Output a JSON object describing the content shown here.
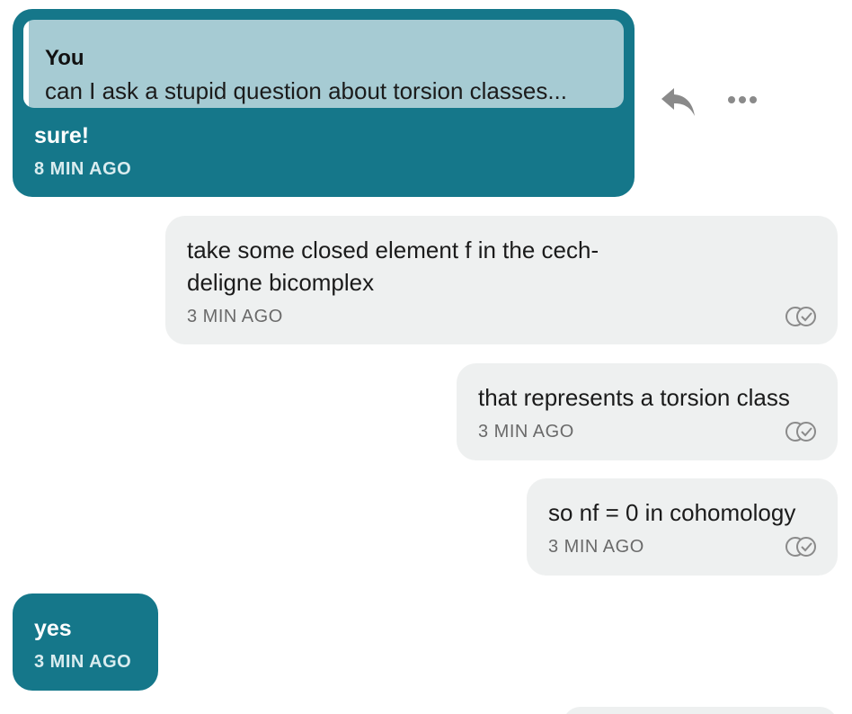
{
  "messages": [
    {
      "reply_to": {
        "author": "You",
        "text": "can I ask a stupid question about torsion classes..."
      },
      "text": "sure!",
      "time": "8 MIN AGO"
    },
    {
      "text_lines": [
        "take some closed element f in the cech-",
        "deligne bicomplex"
      ],
      "time": "3 MIN AGO",
      "status_icon": "double-check-icon"
    },
    {
      "text": "that represents a torsion class",
      "time": "3 MIN AGO",
      "status_icon": "double-check-icon"
    },
    {
      "text": "so nf = 0 in cohomology",
      "time": "3 MIN AGO",
      "status_icon": "double-check-icon"
    },
    {
      "text": "yes",
      "time": "3 MIN AGO"
    }
  ],
  "actions": {
    "reply_icon": "reply-arrow-icon",
    "more_icon": "more-horizontal-icon"
  },
  "colors": {
    "incoming_bubble": "#15778a",
    "quote_background": "#a6cbd3",
    "outgoing_bubble": "#eef0f0",
    "icon_gray": "#8a8a8a"
  }
}
